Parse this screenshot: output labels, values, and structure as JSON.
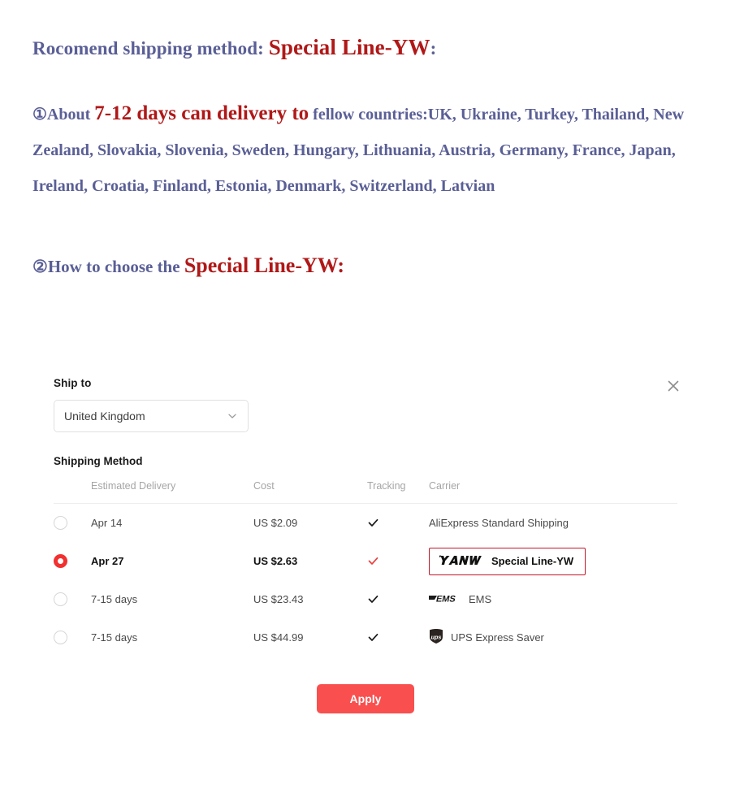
{
  "promo": {
    "headline": {
      "prefix": "Rocomend shipping method: ",
      "emphasis": "Special Line-YW",
      "suffix": ":"
    },
    "countries": {
      "prefix": "①About ",
      "emphasis": "7-12 days can delivery to",
      "suffix": " fellow countries:UK, Ukraine, Turkey, Thailand, New Zealand, Slovakia, Slovenia, Sweden, Hungary, Lithuania, Austria, Germany, France, Japan, Ireland, Croatia, Finland, Estonia, Denmark, Switzerland, Latvian"
    },
    "howto": {
      "prefix": "②How to choose the ",
      "emphasis": "Special Line-YW:"
    },
    "colors": {
      "text": "#5a5f96",
      "emphasis": "#b01818"
    }
  },
  "panel": {
    "close_label": "×",
    "ship_to": {
      "label": "Ship to",
      "selected": "United Kingdom"
    },
    "shipping_method": {
      "title": "Shipping Method",
      "columns": {
        "radio": "",
        "estimated_delivery": "Estimated Delivery",
        "cost": "Cost",
        "tracking": "Tracking",
        "carrier": "Carrier"
      },
      "rows": [
        {
          "selected": false,
          "estimated_delivery": "Apr 14",
          "cost": "US $2.09",
          "tracking": "✓",
          "tracking_color": "#1a1a1a",
          "carrier": "AliExpress Standard Shipping",
          "logo": "none"
        },
        {
          "selected": true,
          "estimated_delivery": "Apr 27",
          "cost": "US $2.63",
          "tracking": "✓",
          "tracking_color": "#e84040",
          "carrier": "Special Line-YW",
          "logo": "yanwen-logo"
        },
        {
          "selected": false,
          "estimated_delivery": "7-15 days",
          "cost": "US $23.43",
          "tracking": "✓",
          "tracking_color": "#1a1a1a",
          "carrier": "EMS",
          "logo": "ems-logo"
        },
        {
          "selected": false,
          "estimated_delivery": "7-15 days",
          "cost": "US $44.99",
          "tracking": "✓",
          "tracking_color": "#1a1a1a",
          "carrier": "UPS Express Saver",
          "logo": "ups-logo"
        }
      ]
    },
    "apply_label": "Apply",
    "colors": {
      "accent": "#f94f4f",
      "selected_radio": "#f23030",
      "highlight_border": "#c2182a"
    }
  }
}
